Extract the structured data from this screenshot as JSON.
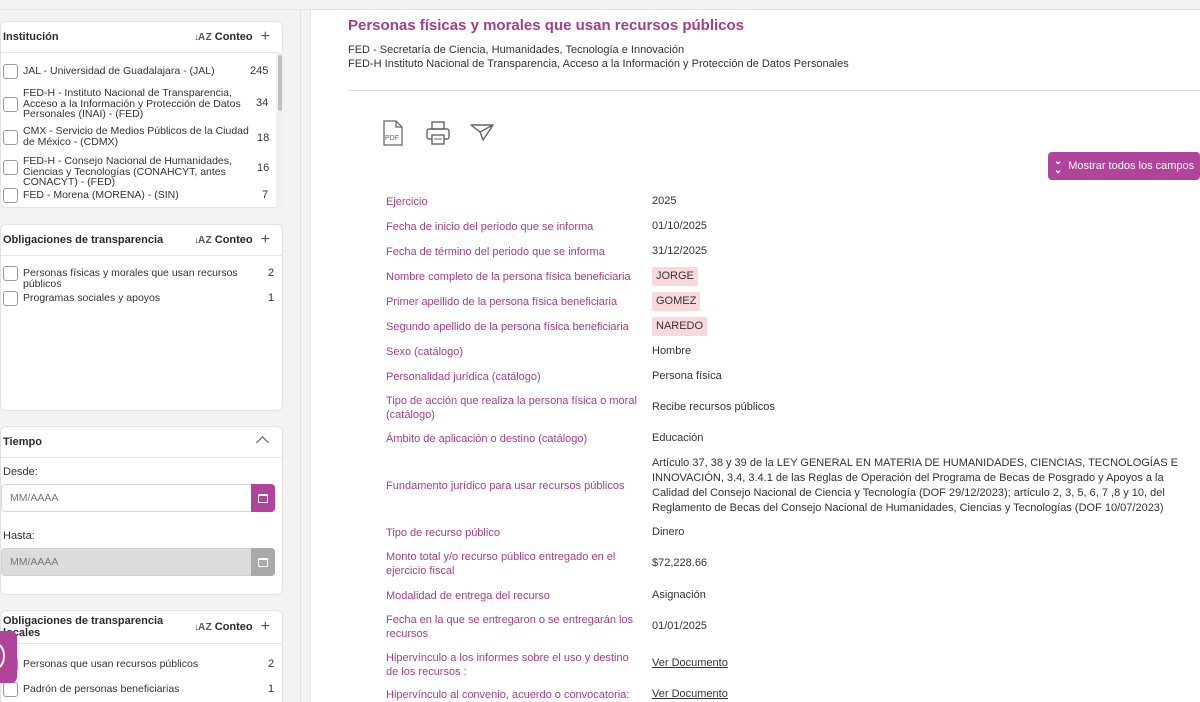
{
  "sidebar": {
    "institucion": {
      "title": "Institución",
      "sort_label": "Conteo",
      "items": [
        {
          "label": "JAL - Universidad de Guadalajara - (JAL)",
          "count": "245"
        },
        {
          "label": "FED-H - Instituto Nacional de Transparencia, Acceso a la Información y Protección de Datos Personales (INAI) - (FED)",
          "count": "34"
        },
        {
          "label": "CMX - Servicio de Medios Públicos de la Ciudad de México - (CDMX)",
          "count": "18"
        },
        {
          "label": "FED-H - Consejo Nacional de Humanidades, Ciencias y Tecnologías (CONAHCYT, antes CONACYT) - (FED)",
          "count": "16"
        },
        {
          "label": "FED - Morena (MORENA) - (SIN)",
          "count": "7"
        }
      ]
    },
    "obligaciones": {
      "title": "Obligaciones de transparencia",
      "sort_label": "Conteo",
      "items": [
        {
          "label": "Personas físicas y morales que usan recursos públicos",
          "count": "2"
        },
        {
          "label": "Programas sociales y apoyos",
          "count": "1"
        }
      ]
    },
    "tiempo": {
      "title": "Tiempo",
      "desde_label": "Desde:",
      "desde_placeholder": "MM/AAAA",
      "hasta_label": "Hasta:",
      "hasta_placeholder": "MM/AAAA"
    },
    "obligaciones_locales": {
      "title_line1": "Obligaciones de transparencia",
      "title_line2": "locales",
      "sort_label": "Conteo",
      "items": [
        {
          "label": "Personas que usan recursos públicos",
          "count": "2"
        },
        {
          "label": "Padrón de personas beneficiarias",
          "count": "1"
        }
      ]
    }
  },
  "main": {
    "title": "Personas físicas y morales que usan recursos públicos",
    "subtitle_1": "FED - Secretaría de Ciencia, Humanidades, Tecnología e Innovación",
    "subtitle_2": "FED-H Instituto Nacional de Transparencia, Acceso a la Información y Protección de Datos Personales",
    "pdf_text": "PDF",
    "show_all_label": "Mostrar todos los campos",
    "fields": [
      {
        "label": "Ejercicio",
        "value": "2025"
      },
      {
        "label": "Fecha de inicio del periodo que se informa",
        "value": "01/10/2025"
      },
      {
        "label": "Fecha de término del periodo que se informa",
        "value": "31/12/2025"
      },
      {
        "label": "Nombre completo de la persona física beneficiaria",
        "value": "JORGE"
      },
      {
        "label": "Primer apellido de la persona física beneficiaria",
        "value": "GOMEZ"
      },
      {
        "label": "Segundo apellido de la persona física beneficiaria",
        "value": "NAREDO"
      },
      {
        "label": "Sexo (catálogo)",
        "value": "Hombre"
      },
      {
        "label": "Personalidad jurídica (catálogo)",
        "value": "Persona física"
      },
      {
        "label": "Tipo de acción que realiza la persona física o moral (catálogo)",
        "value": "Recibe recursos públicos"
      },
      {
        "label": "Ámbito de aplicación o destino (catálogo)",
        "value": "Educación"
      },
      {
        "label": "Fundamento jurídico para usar recursos públicos",
        "value": "Artículo 37, 38 y 39 de la LEY GENERAL EN MATERIA DE HUMANIDADES, CIENCIAS, TECNOLOGÍAS E INNOVACIÓN, 3.4, 3.4.1 de las Reglas de Operación del Programa de Becas de Posgrado y Apoyos a la Calidad del Consejo Nacional de Ciencia y Tecnología (DOF 29/12/2023); artículo 2, 3, 5, 6, 7 ,8 y 10, del Reglamento de Becas del Consejo Nacional de Humanidades, Ciencias y Tecnologías (DOF 10/07/2023)"
      },
      {
        "label": "Tipo de recurso público",
        "value": "Dinero"
      },
      {
        "label": "Monto total y/o recurso público entregado en el ejercicio fiscal",
        "value": "$72,228.66"
      },
      {
        "label": "Modalidad de entrega del recurso",
        "value": "Asignación"
      },
      {
        "label": "Fecha en la que se entregaron o se entregarán los recursos",
        "value": "01/01/2025"
      },
      {
        "label": "Hipervínculo a los informes sobre el uso y destino de los recursos :",
        "value": "Ver Documento"
      },
      {
        "label": "Hipervínculo al convenio, acuerdo o convocatoria:",
        "value": "Ver Documento"
      }
    ]
  },
  "colors": {
    "accent": "#b0449a",
    "label_text": "#a23e8e",
    "highlight": "#f9d8dc"
  }
}
